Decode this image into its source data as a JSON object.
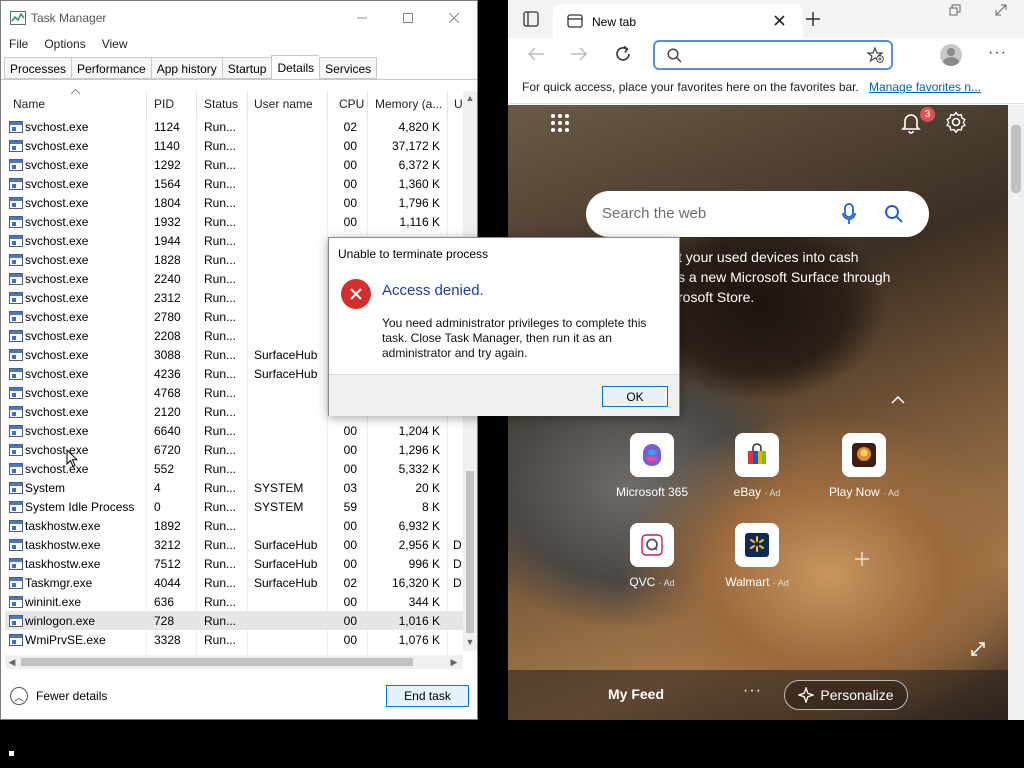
{
  "task_manager": {
    "title": "Task Manager",
    "menu": [
      "File",
      "Options",
      "View"
    ],
    "tabs": [
      "Processes",
      "Performance",
      "App history",
      "Startup",
      "Details",
      "Services"
    ],
    "active_tab": "Details",
    "columns": {
      "name": "Name",
      "pid": "PID",
      "status": "Status",
      "user": "User name",
      "cpu": "CPU",
      "memory": "Memory (a...",
      "u": "U"
    },
    "rows": [
      {
        "name": "svchost.exe",
        "pid": "1124",
        "status": "Run...",
        "user": "",
        "cpu": "02",
        "mem": "4,820 K",
        "u": ""
      },
      {
        "name": "svchost.exe",
        "pid": "1140",
        "status": "Run...",
        "user": "",
        "cpu": "00",
        "mem": "37,172 K",
        "u": ""
      },
      {
        "name": "svchost.exe",
        "pid": "1292",
        "status": "Run...",
        "user": "",
        "cpu": "00",
        "mem": "6,372 K",
        "u": ""
      },
      {
        "name": "svchost.exe",
        "pid": "1564",
        "status": "Run...",
        "user": "",
        "cpu": "00",
        "mem": "1,360 K",
        "u": ""
      },
      {
        "name": "svchost.exe",
        "pid": "1804",
        "status": "Run...",
        "user": "",
        "cpu": "00",
        "mem": "1,796 K",
        "u": ""
      },
      {
        "name": "svchost.exe",
        "pid": "1932",
        "status": "Run...",
        "user": "",
        "cpu": "00",
        "mem": "1,116 K",
        "u": ""
      },
      {
        "name": "svchost.exe",
        "pid": "1944",
        "status": "Run...",
        "user": "",
        "cpu": "",
        "mem": "",
        "u": ""
      },
      {
        "name": "svchost.exe",
        "pid": "1828",
        "status": "Run...",
        "user": "",
        "cpu": "",
        "mem": "",
        "u": ""
      },
      {
        "name": "svchost.exe",
        "pid": "2240",
        "status": "Run...",
        "user": "",
        "cpu": "",
        "mem": "",
        "u": ""
      },
      {
        "name": "svchost.exe",
        "pid": "2312",
        "status": "Run...",
        "user": "",
        "cpu": "",
        "mem": "",
        "u": ""
      },
      {
        "name": "svchost.exe",
        "pid": "2780",
        "status": "Run...",
        "user": "",
        "cpu": "",
        "mem": "",
        "u": ""
      },
      {
        "name": "svchost.exe",
        "pid": "2208",
        "status": "Run...",
        "user": "",
        "cpu": "",
        "mem": "",
        "u": ""
      },
      {
        "name": "svchost.exe",
        "pid": "3088",
        "status": "Run...",
        "user": "SurfaceHub",
        "cpu": "",
        "mem": "",
        "u": ""
      },
      {
        "name": "svchost.exe",
        "pid": "4236",
        "status": "Run...",
        "user": "SurfaceHub",
        "cpu": "",
        "mem": "",
        "u": ""
      },
      {
        "name": "svchost.exe",
        "pid": "4768",
        "status": "Run...",
        "user": "",
        "cpu": "",
        "mem": "",
        "u": ""
      },
      {
        "name": "svchost.exe",
        "pid": "2120",
        "status": "Run...",
        "user": "",
        "cpu": "",
        "mem": "",
        "u": ""
      },
      {
        "name": "svchost.exe",
        "pid": "6640",
        "status": "Run...",
        "user": "",
        "cpu": "00",
        "mem": "1,204 K",
        "u": ""
      },
      {
        "name": "svchost.exe",
        "pid": "6720",
        "status": "Run...",
        "user": "",
        "cpu": "00",
        "mem": "1,296 K",
        "u": ""
      },
      {
        "name": "svchost.exe",
        "pid": "552",
        "status": "Run...",
        "user": "",
        "cpu": "00",
        "mem": "5,332 K",
        "u": ""
      },
      {
        "name": "System",
        "pid": "4",
        "status": "Run...",
        "user": "SYSTEM",
        "cpu": "03",
        "mem": "20 K",
        "u": ""
      },
      {
        "name": "System Idle Process",
        "pid": "0",
        "status": "Run...",
        "user": "SYSTEM",
        "cpu": "59",
        "mem": "8 K",
        "u": ""
      },
      {
        "name": "taskhostw.exe",
        "pid": "1892",
        "status": "Run...",
        "user": "",
        "cpu": "00",
        "mem": "6,932 K",
        "u": ""
      },
      {
        "name": "taskhostw.exe",
        "pid": "3212",
        "status": "Run...",
        "user": "SurfaceHub",
        "cpu": "00",
        "mem": "2,956 K",
        "u": "D"
      },
      {
        "name": "taskhostw.exe",
        "pid": "7512",
        "status": "Run...",
        "user": "SurfaceHub",
        "cpu": "00",
        "mem": "996 K",
        "u": "D"
      },
      {
        "name": "Taskmgr.exe",
        "pid": "4044",
        "status": "Run...",
        "user": "SurfaceHub",
        "cpu": "02",
        "mem": "16,320 K",
        "u": "D"
      },
      {
        "name": "wininit.exe",
        "pid": "636",
        "status": "Run...",
        "user": "",
        "cpu": "00",
        "mem": "344 K",
        "u": ""
      },
      {
        "name": "winlogon.exe",
        "pid": "728",
        "status": "Run...",
        "user": "",
        "cpu": "00",
        "mem": "1,016 K",
        "u": ""
      },
      {
        "name": "WmiPrvSE.exe",
        "pid": "3328",
        "status": "Run...",
        "user": "",
        "cpu": "00",
        "mem": "1,076 K",
        "u": ""
      }
    ],
    "selected_row": 26,
    "fewer_details": "Fewer details",
    "end_task": "End task"
  },
  "dialog": {
    "title": "Unable to terminate process",
    "heading": "Access denied.",
    "message": "You need administrator privileges to complete this task. Close Task Manager, then run it as an administrator and try again.",
    "ok": "OK"
  },
  "edge": {
    "tab_title": "New tab",
    "favbar_text": "For quick access, place your favorites here on the favorites bar.",
    "favbar_link": "Manage favorites n...",
    "notification_count": "3",
    "search_placeholder": "Search the web",
    "promo_text": "t your used devices into cash\ns a new Microsoft Surface through\nrosoft Store.",
    "tiles": [
      {
        "label": "Microsoft 365",
        "ad": ""
      },
      {
        "label": "eBay",
        "ad": "· Ad"
      },
      {
        "label": "Play Now",
        "ad": "· Ad"
      },
      {
        "label": "QVC",
        "ad": "· Ad"
      },
      {
        "label": "Walmart",
        "ad": "· Ad"
      }
    ],
    "my_feed": "My Feed",
    "personalize": "Personalize"
  },
  "colors": {
    "accent": "#0078d7",
    "error": "#d32f2f",
    "link": "#0060c0"
  }
}
